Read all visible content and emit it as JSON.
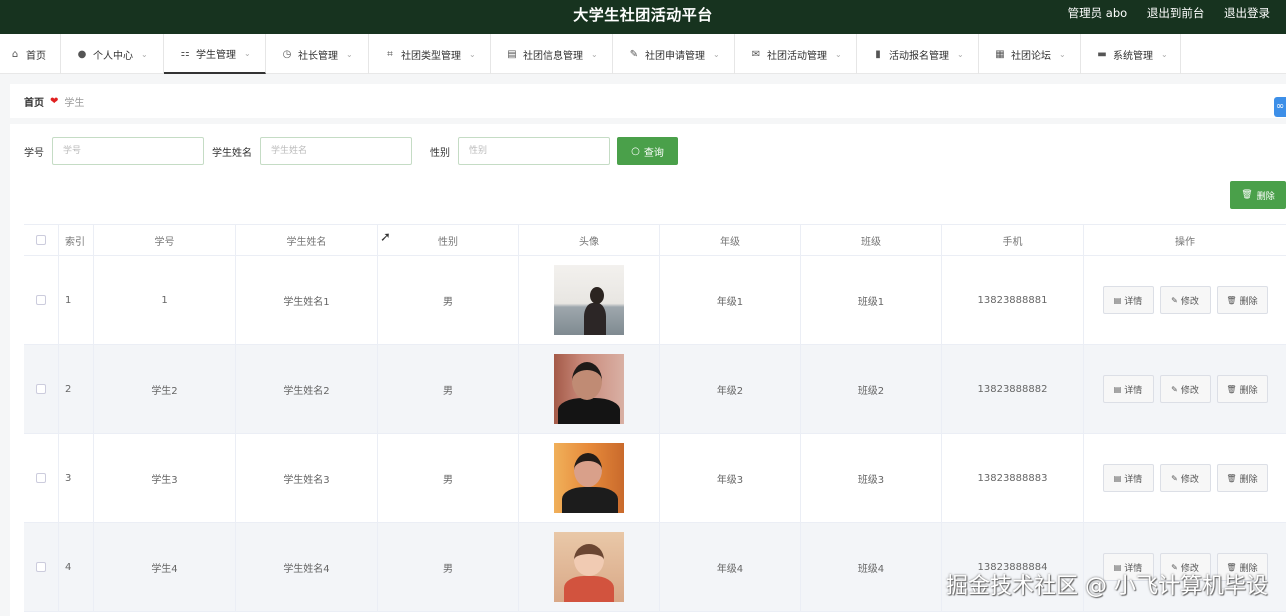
{
  "header": {
    "title": "大学生社团活动平台",
    "admin_label": "管理员 abo",
    "back_front": "退出到前台",
    "logout": "退出登录"
  },
  "nav": [
    {
      "label": "首页",
      "icon": "home-icon",
      "glyph": "⌂",
      "has_arrow": false
    },
    {
      "label": "个人中心",
      "icon": "user-icon",
      "glyph": "👤",
      "has_arrow": true
    },
    {
      "label": "学生管理",
      "icon": "grid-icon",
      "glyph": "⚏",
      "has_arrow": true,
      "active": true
    },
    {
      "label": "社长管理",
      "icon": "clock-icon",
      "glyph": "◷",
      "has_arrow": true
    },
    {
      "label": "社团类型管理",
      "icon": "crop-icon",
      "glyph": "⌗",
      "has_arrow": true
    },
    {
      "label": "社团信息管理",
      "icon": "clipboard-icon",
      "glyph": "▤",
      "has_arrow": true
    },
    {
      "label": "社团申请管理",
      "icon": "pen-icon",
      "glyph": "✎",
      "has_arrow": true
    },
    {
      "label": "社团活动管理",
      "icon": "mail-icon",
      "glyph": "✉",
      "has_arrow": true
    },
    {
      "label": "活动报名管理",
      "icon": "chart-icon",
      "glyph": "▮",
      "has_arrow": true
    },
    {
      "label": "社团论坛",
      "icon": "table-icon",
      "glyph": "▦",
      "has_arrow": true
    },
    {
      "label": "系统管理",
      "icon": "monitor-icon",
      "glyph": "▬",
      "has_arrow": true
    }
  ],
  "breadcrumb": {
    "home": "首页",
    "current": "学生"
  },
  "search": {
    "no_label": "学号",
    "no_placeholder": "学号",
    "name_label": "学生姓名",
    "name_placeholder": "学生姓名",
    "sex_label": "性别",
    "sex_placeholder": "性别",
    "query_button": "查询"
  },
  "delete_button": "删除",
  "table": {
    "headers": {
      "index": "索引",
      "no": "学号",
      "name": "学生姓名",
      "sex": "性别",
      "avatar": "头像",
      "grade": "年级",
      "class": "班级",
      "phone": "手机",
      "ops": "操作"
    },
    "rows": [
      {
        "index": "1",
        "no": "1",
        "name": "学生姓名1",
        "sex": "男",
        "grade": "年级1",
        "class": "班级1",
        "phone": "13823888881"
      },
      {
        "index": "2",
        "no": "学生2",
        "name": "学生姓名2",
        "sex": "男",
        "grade": "年级2",
        "class": "班级2",
        "phone": "13823888882"
      },
      {
        "index": "3",
        "no": "学生3",
        "name": "学生姓名3",
        "sex": "男",
        "grade": "年级3",
        "class": "班级3",
        "phone": "13823888883"
      },
      {
        "index": "4",
        "no": "学生4",
        "name": "学生姓名4",
        "sex": "男",
        "grade": "年级4",
        "class": "班级4",
        "phone": "13823888884"
      }
    ],
    "ops": {
      "detail": "详情",
      "edit": "修改",
      "delete": "删除"
    }
  },
  "watermark": "掘金技术社区 @ 小飞计算机毕设",
  "colors": {
    "header_bg": "#17331f",
    "accent_green": "#4aa04a",
    "heart": "#e02020"
  }
}
